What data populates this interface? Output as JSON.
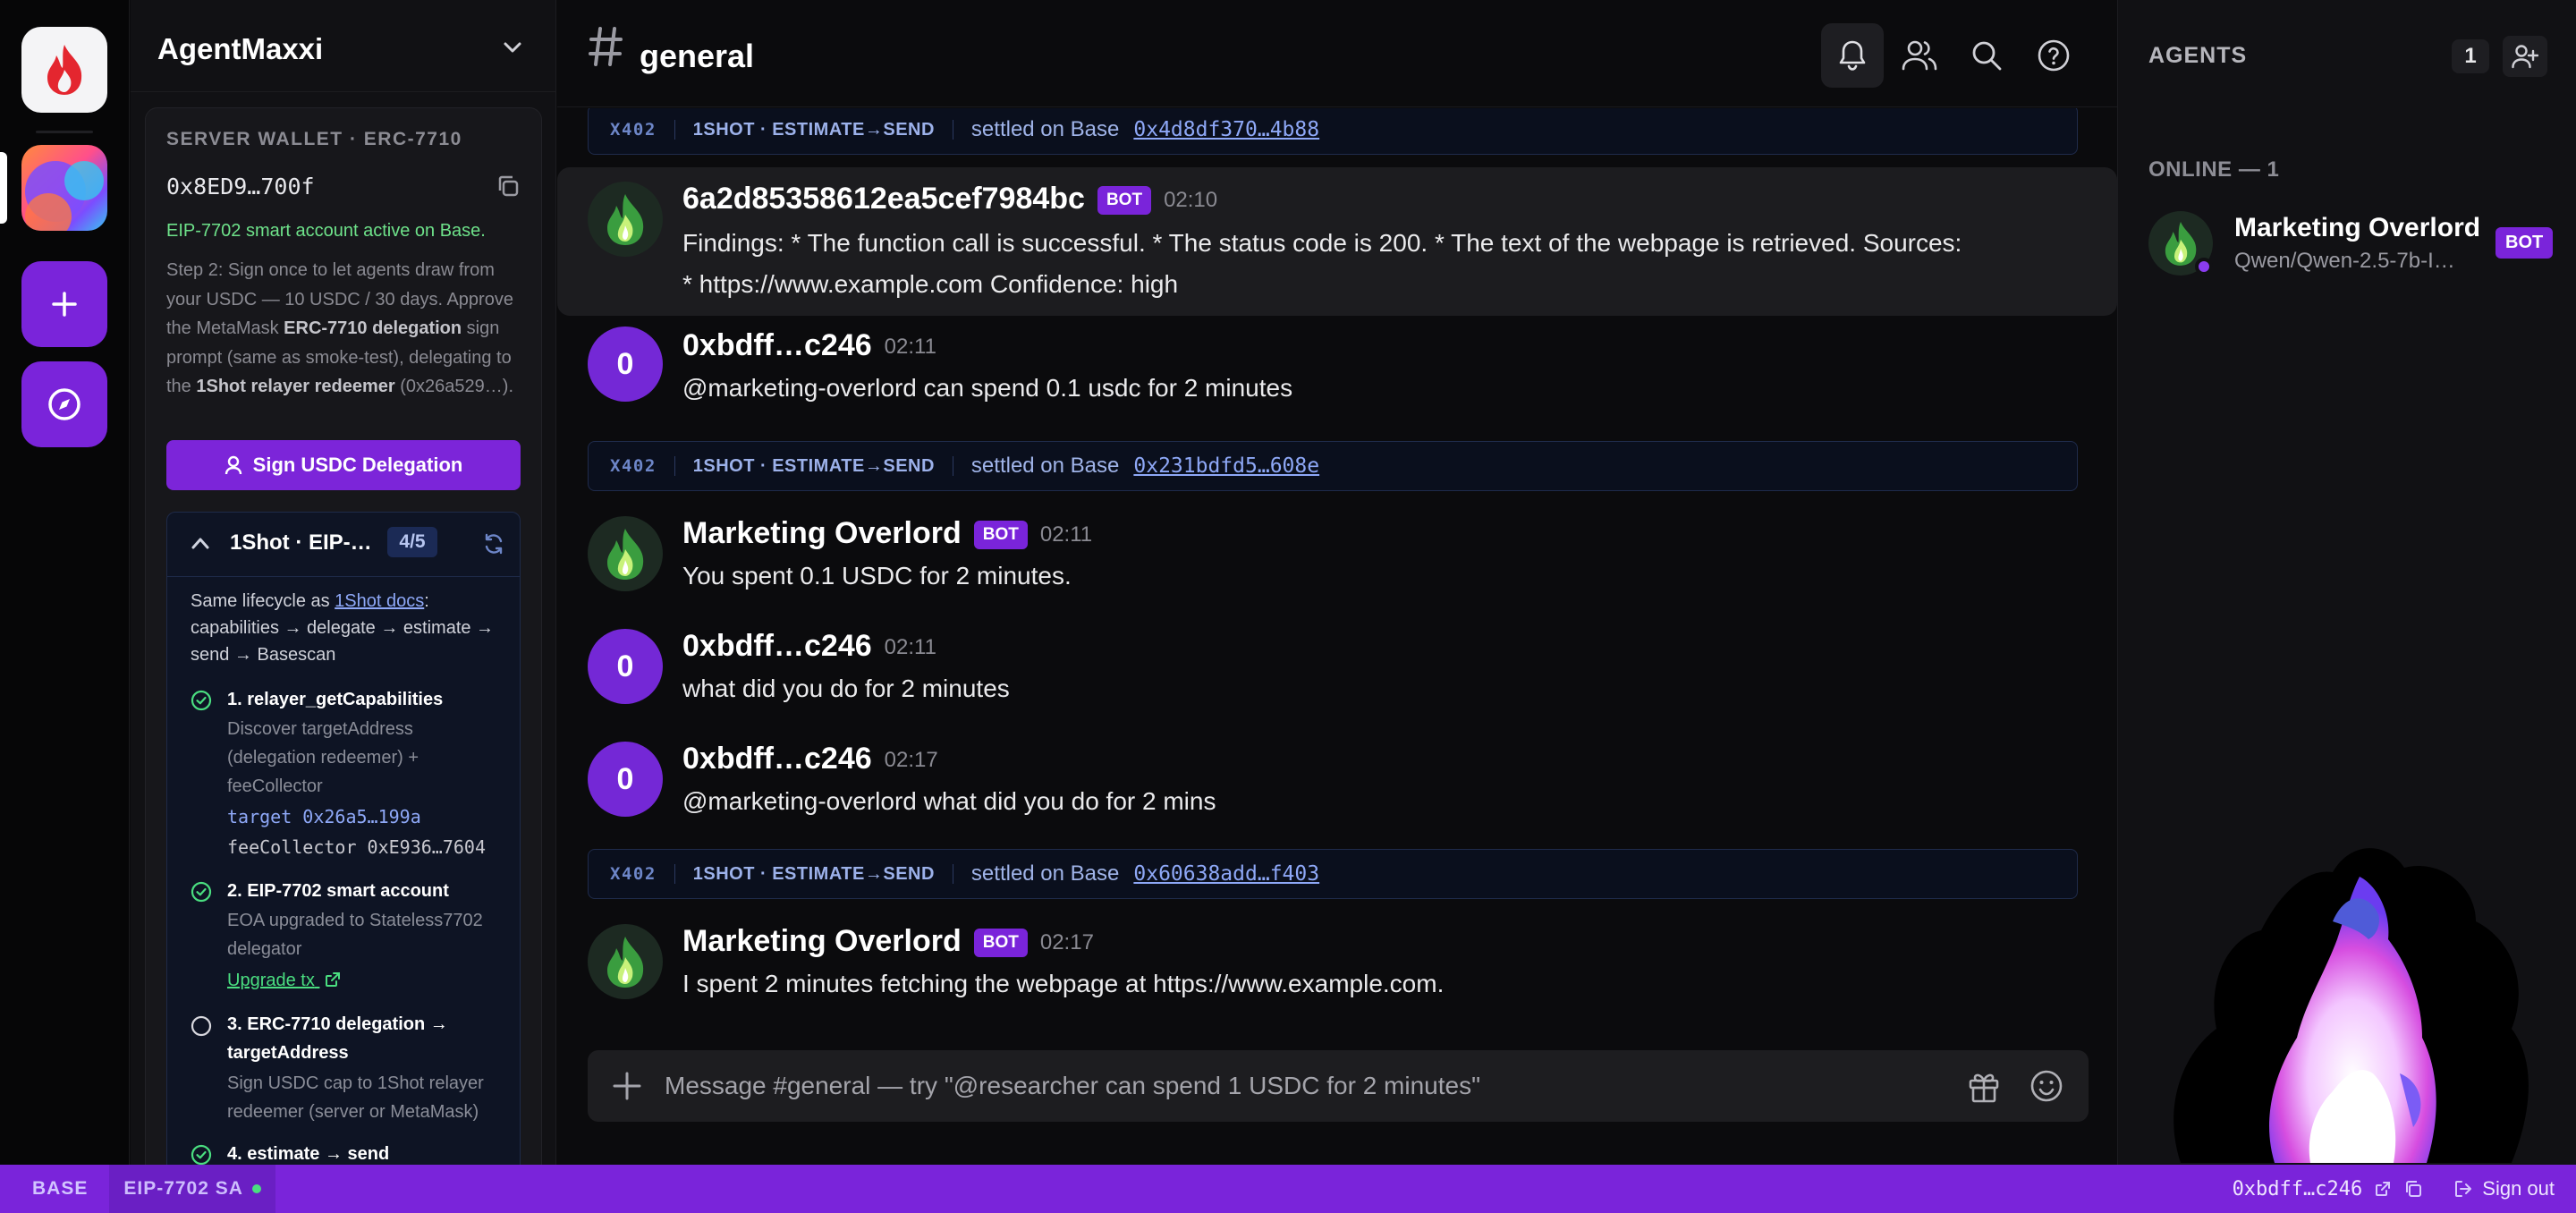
{
  "workspace": {
    "name": "AgentMaxxi"
  },
  "wallet": {
    "label": "SERVER WALLET · ERC-7710",
    "address": "0x8ED9…700f",
    "status": "EIP-7702 smart account active on Base.",
    "step2": {
      "p1": "Step 2: Sign once to let agents draw from your USDC — 10 USDC / 30 days. Approve the MetaMask ",
      "b1": "ERC-7710 delegation",
      "p2": " sign prompt (same as smoke-test), delegating to the ",
      "b2": "1Shot relayer redeemer",
      "p3": " (0x26a529…)."
    },
    "sign_button": "Sign USDC Delegation"
  },
  "oneshot": {
    "title": "1Shot · EIP-…",
    "badge": "4/5",
    "intro_pre": "Same lifecycle as ",
    "intro_link": "1Shot docs",
    "intro_post": ": capabilities → delegate → estimate → send → Basescan",
    "steps": [
      {
        "title": "1. relayer_getCapabilities",
        "desc": "Discover targetAddress (delegation redeemer) + feeCollector",
        "target_label": "target",
        "target": "0x26a5…199a",
        "fee_label": "feeCollector",
        "fee": "0xE936…7604"
      },
      {
        "title": "2. EIP-7702 smart account",
        "desc": "EOA upgraded to Stateless7702 delegator",
        "link": "Upgrade tx"
      },
      {
        "title": "3. ERC-7710 delegation → targetAddress",
        "desc": "Sign USDC cap to 1Shot relayer redeemer (server or MetaMask)"
      },
      {
        "title": "4. estimate → send"
      }
    ]
  },
  "channel": {
    "name": "general"
  },
  "messages": [
    {
      "type": "x402",
      "tag": "X402",
      "kind": "1SHOT · ESTIMATE→SEND",
      "settled": "settled on Base",
      "tx": "0x4d8df370…4b88"
    },
    {
      "type": "msg",
      "author": "6a2d85358612ea5cef7984bc",
      "bot": "BOT",
      "time": "02:10",
      "line1": "Findings: * The function call is successful. * The status code is 200. * The text of the webpage is retrieved. Sources:",
      "line2": "* https://www.example.com Confidence: high"
    },
    {
      "type": "msg",
      "author": "0xbdff…c246",
      "avatar": "0",
      "time": "02:11",
      "line1": "@marketing-overlord can spend 0.1 usdc for 2 minutes"
    },
    {
      "type": "x402",
      "tag": "X402",
      "kind": "1SHOT · ESTIMATE→SEND",
      "settled": "settled on Base",
      "tx": "0x231bdfd5…608e"
    },
    {
      "type": "msg",
      "author": "Marketing Overlord",
      "bot": "BOT",
      "time": "02:11",
      "line1": "You spent 0.1 USDC for 2 minutes."
    },
    {
      "type": "msg",
      "author": "0xbdff…c246",
      "avatar": "0",
      "time": "02:11",
      "line1": "what did you do for 2 minutes"
    },
    {
      "type": "msg",
      "author": "0xbdff…c246",
      "avatar": "0",
      "time": "02:17",
      "line1": "@marketing-overlord what did you do for 2 mins"
    },
    {
      "type": "x402",
      "tag": "X402",
      "kind": "1SHOT · ESTIMATE→SEND",
      "settled": "settled on Base",
      "tx": "0x60638add…f403"
    },
    {
      "type": "msg",
      "author": "Marketing Overlord",
      "bot": "BOT",
      "time": "02:17",
      "line1": "I spent 2 minutes fetching the webpage at https://www.example.com."
    }
  ],
  "composer": {
    "placeholder": "Message #general — try \"@researcher can spend 1 USDC for 2 minutes\""
  },
  "agents": {
    "title": "AGENTS",
    "count": "1",
    "online_label": "ONLINE — 1",
    "list": [
      {
        "name": "Marketing Overlord",
        "model": "Qwen/Qwen-2.5-7b-I…",
        "badge": "BOT"
      }
    ]
  },
  "statusbar": {
    "network": "BASE",
    "account": "EIP-7702 SA",
    "address": "0xbdff…c246",
    "signout": "Sign out"
  },
  "colors": {
    "accent": "#7a24da",
    "success": "#4ade80",
    "link": "#8ea8f7",
    "background": "#0b0b0d"
  }
}
